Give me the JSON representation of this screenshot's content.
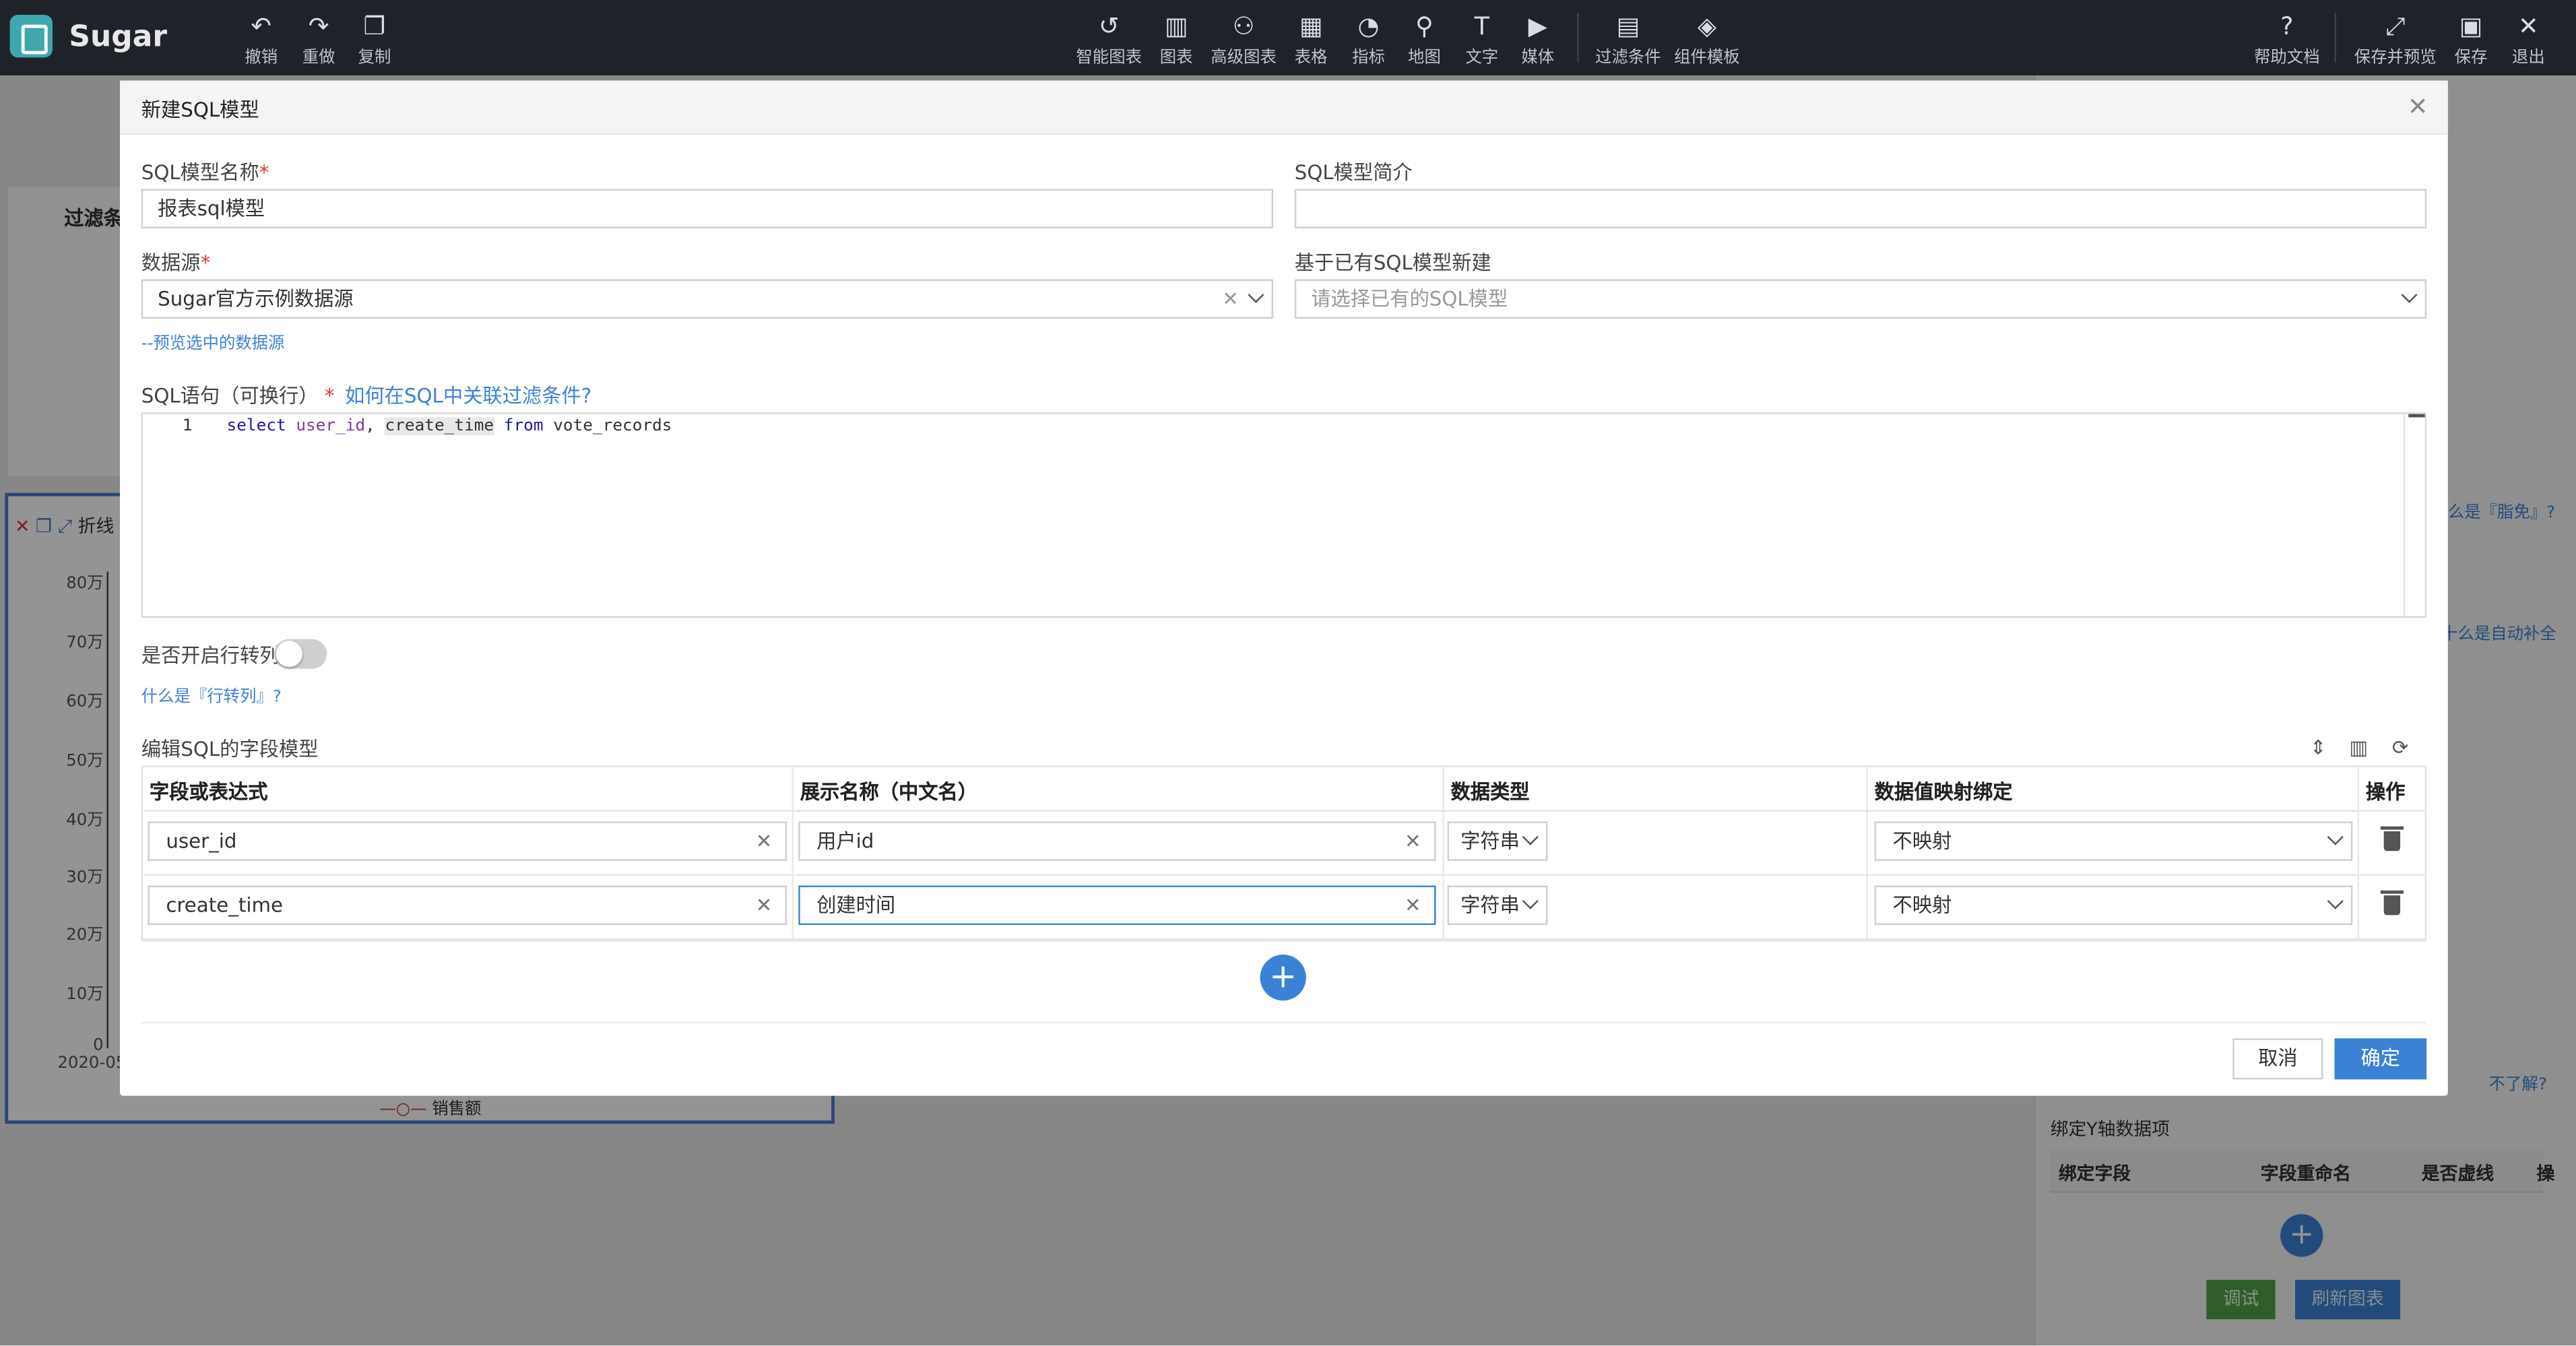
{
  "app": {
    "name": "Sugar"
  },
  "toolbar": {
    "left": [
      {
        "label": "撤销",
        "icon": "undo-icon",
        "glyph": "↶"
      },
      {
        "label": "重做",
        "icon": "redo-icon",
        "glyph": "↷"
      },
      {
        "label": "复制",
        "icon": "copy-icon",
        "glyph": "❐"
      }
    ],
    "center": [
      {
        "label": "智能图表",
        "icon": "smart-chart-icon",
        "glyph": "↺"
      },
      {
        "label": "图表",
        "icon": "bar-chart-icon",
        "glyph": "▥"
      },
      {
        "label": "高级图表",
        "icon": "advanced-chart-icon",
        "glyph": "⚇"
      },
      {
        "label": "表格",
        "icon": "table-icon",
        "glyph": "▦"
      },
      {
        "label": "指标",
        "icon": "gauge-icon",
        "glyph": "◔"
      },
      {
        "label": "地图",
        "icon": "map-icon",
        "glyph": "⚲"
      },
      {
        "label": "文字",
        "icon": "text-icon",
        "glyph": "T"
      },
      {
        "label": "媒体",
        "icon": "media-icon",
        "glyph": "▶"
      },
      {
        "label": "过滤条件",
        "icon": "filter-icon",
        "glyph": "▤"
      },
      {
        "label": "组件模板",
        "icon": "template-icon",
        "glyph": "◈"
      }
    ],
    "right": [
      {
        "label": "帮助文档",
        "icon": "help-icon",
        "glyph": "?"
      },
      {
        "label": "保存并预览",
        "icon": "save-preview-icon",
        "glyph": "⤢"
      },
      {
        "label": "保存",
        "icon": "save-icon",
        "glyph": "▣"
      },
      {
        "label": "退出",
        "icon": "exit-icon",
        "glyph": "✕"
      }
    ]
  },
  "background": {
    "filter_title": "过滤条",
    "chart_title": "折线",
    "y_ticks": [
      "80万",
      "70万",
      "60万",
      "50万",
      "40万",
      "30万",
      "20万",
      "10万",
      "0"
    ],
    "x_first": "2020-05",
    "legend": "销售额",
    "right_panel": {
      "link1": "么是『脂免』?",
      "link2": "十么是自动补全",
      "link3": "不了解?",
      "y_axis_section": "绑定Y轴数据项",
      "col_bind_field": "绑定字段",
      "col_rename": "字段重命名",
      "col_dashed": "是否虚线",
      "col_op": "操",
      "debug_button": "调试",
      "refresh_button": "刷新图表"
    }
  },
  "modal": {
    "title": "新建SQL模型",
    "name_label": "SQL模型名称",
    "name_value": "报表sql模型",
    "desc_label": "SQL模型简介",
    "desc_value": "",
    "datasource_label": "数据源",
    "datasource_value": "Sugar官方示例数据源",
    "based_on_label": "基于已有SQL模型新建",
    "based_on_placeholder": "请选择已有的SQL模型",
    "preview_link": "--预览选中的数据源",
    "sql_label": "SQL语句（可换行）",
    "sql_help_link": "如何在SQL中关联过滤条件?",
    "sql_line_number": "1",
    "pivot_label": "是否开启行转列",
    "pivot_help_link": "什么是『行转列』?",
    "fields_section_label": "编辑SQL的字段模型",
    "columns": [
      "字段或表达式",
      "展示名称（中文名）",
      "数据类型",
      "数据值映射绑定",
      "操作"
    ],
    "rows": [
      {
        "expr": "user_id",
        "display": "用户id",
        "type": "字符串",
        "mapping": "不映射"
      },
      {
        "expr": "create_time",
        "display": "创建时间",
        "type": "字符串",
        "mapping": "不映射"
      }
    ],
    "cancel_button": "取消",
    "ok_button": "确定"
  }
}
